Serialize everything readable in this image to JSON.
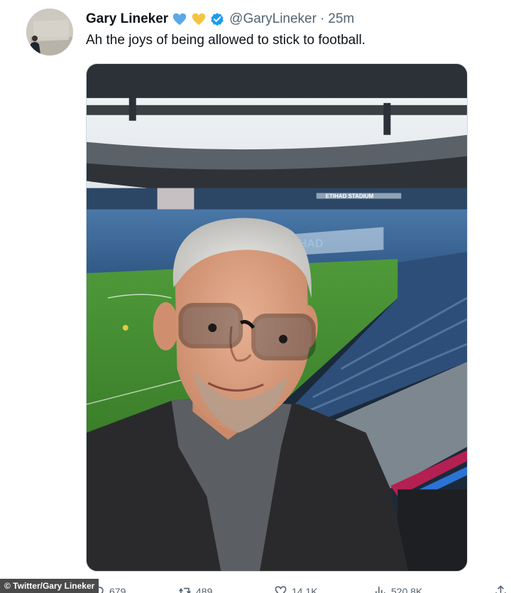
{
  "tweet": {
    "display_name": "Gary Lineker",
    "name_emojis": [
      "blue-heart-icon",
      "yellow-heart-icon"
    ],
    "verified": true,
    "handle": "@GaryLineker",
    "separator": "·",
    "time": "25m",
    "text": "Ah the joys of being allowed to stick to football.",
    "media": {
      "stadium_sign": "ETIHAD STADIUM",
      "stand_letters": "HAD"
    }
  },
  "actions": {
    "reply_count": "679",
    "retweet_count": "489",
    "like_count": "14.1K",
    "views_count": "520.8K"
  },
  "credit": "© Twitter/Gary Lineker",
  "colors": {
    "text_primary": "#0f1419",
    "text_secondary": "#536471",
    "verified_blue": "#1d9bf0",
    "heart_blue": "#5aa9e6",
    "heart_yellow": "#f5c542"
  }
}
